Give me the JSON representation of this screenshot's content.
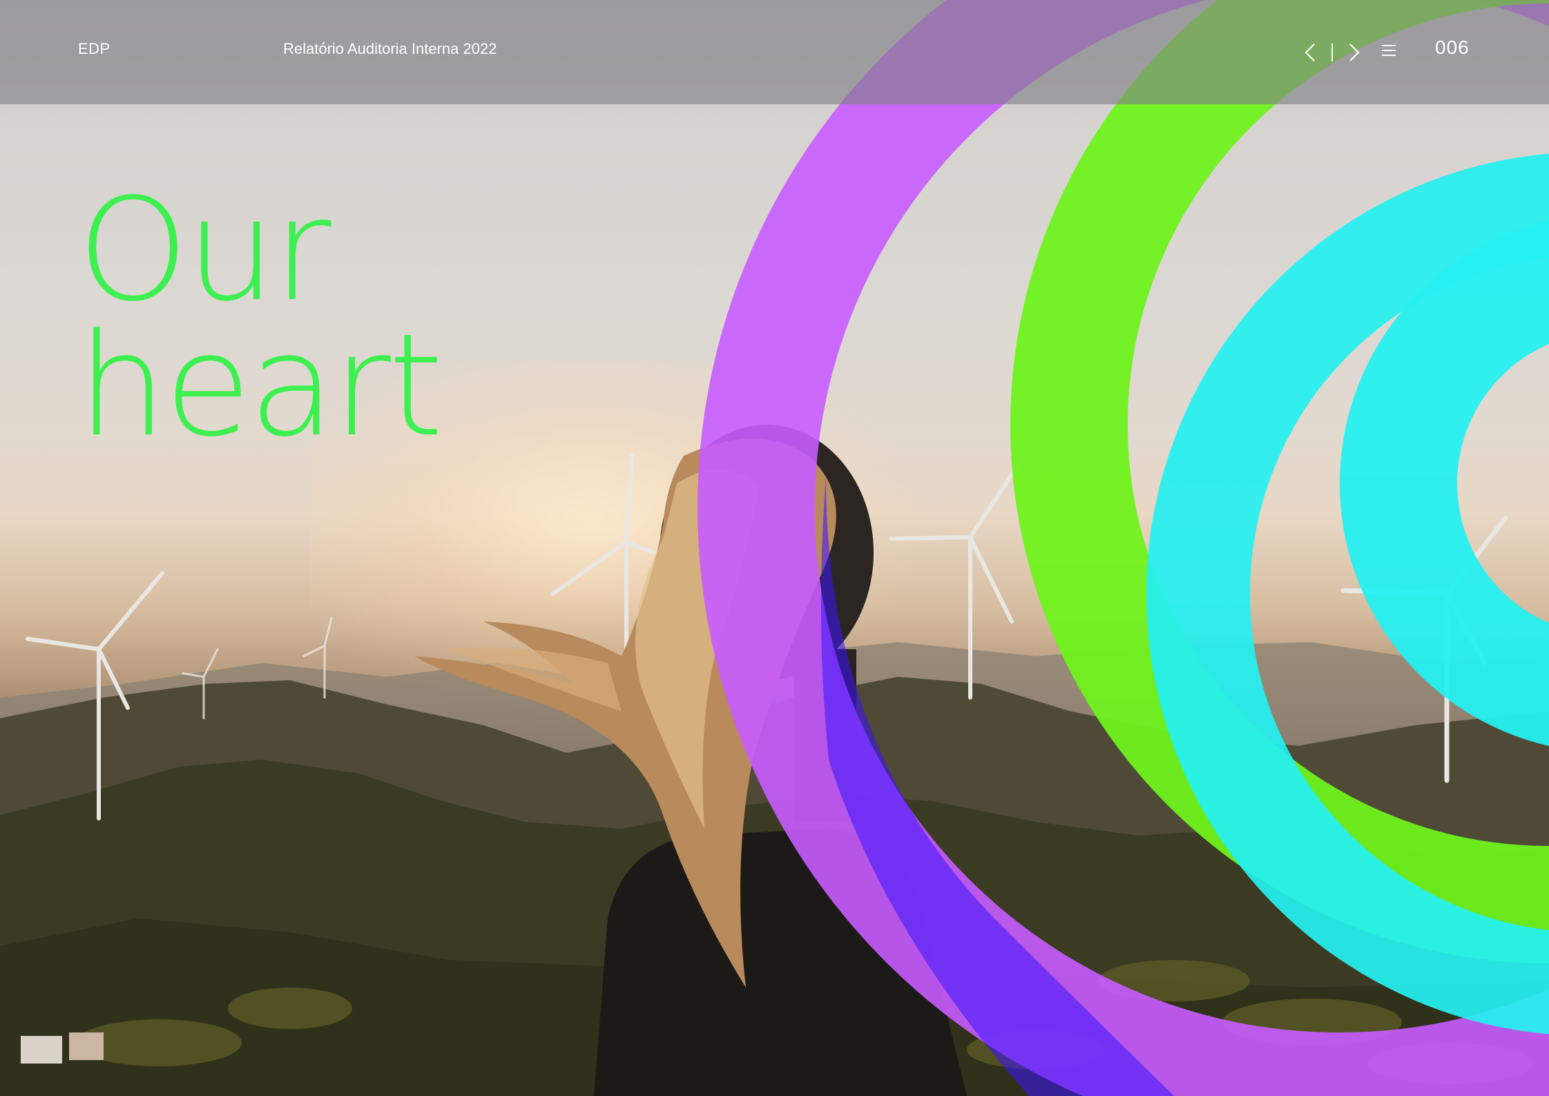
{
  "header": {
    "brand": "EDP",
    "document_title": "Relatório Auditoria Interna 2022",
    "page_number": "006",
    "nav": {
      "prev_icon": "chevron-left-icon",
      "next_icon": "chevron-right-icon",
      "menu_icon": "menu-icon"
    }
  },
  "hero": {
    "heading_line1": "Our",
    "heading_line2": "heart"
  },
  "colors": {
    "heading": "#3cf04f",
    "ring_purple": "#c85cff",
    "ring_green": "#6ff21e",
    "ring_cyan": "#25f0f0",
    "header_bar": "#808084"
  }
}
